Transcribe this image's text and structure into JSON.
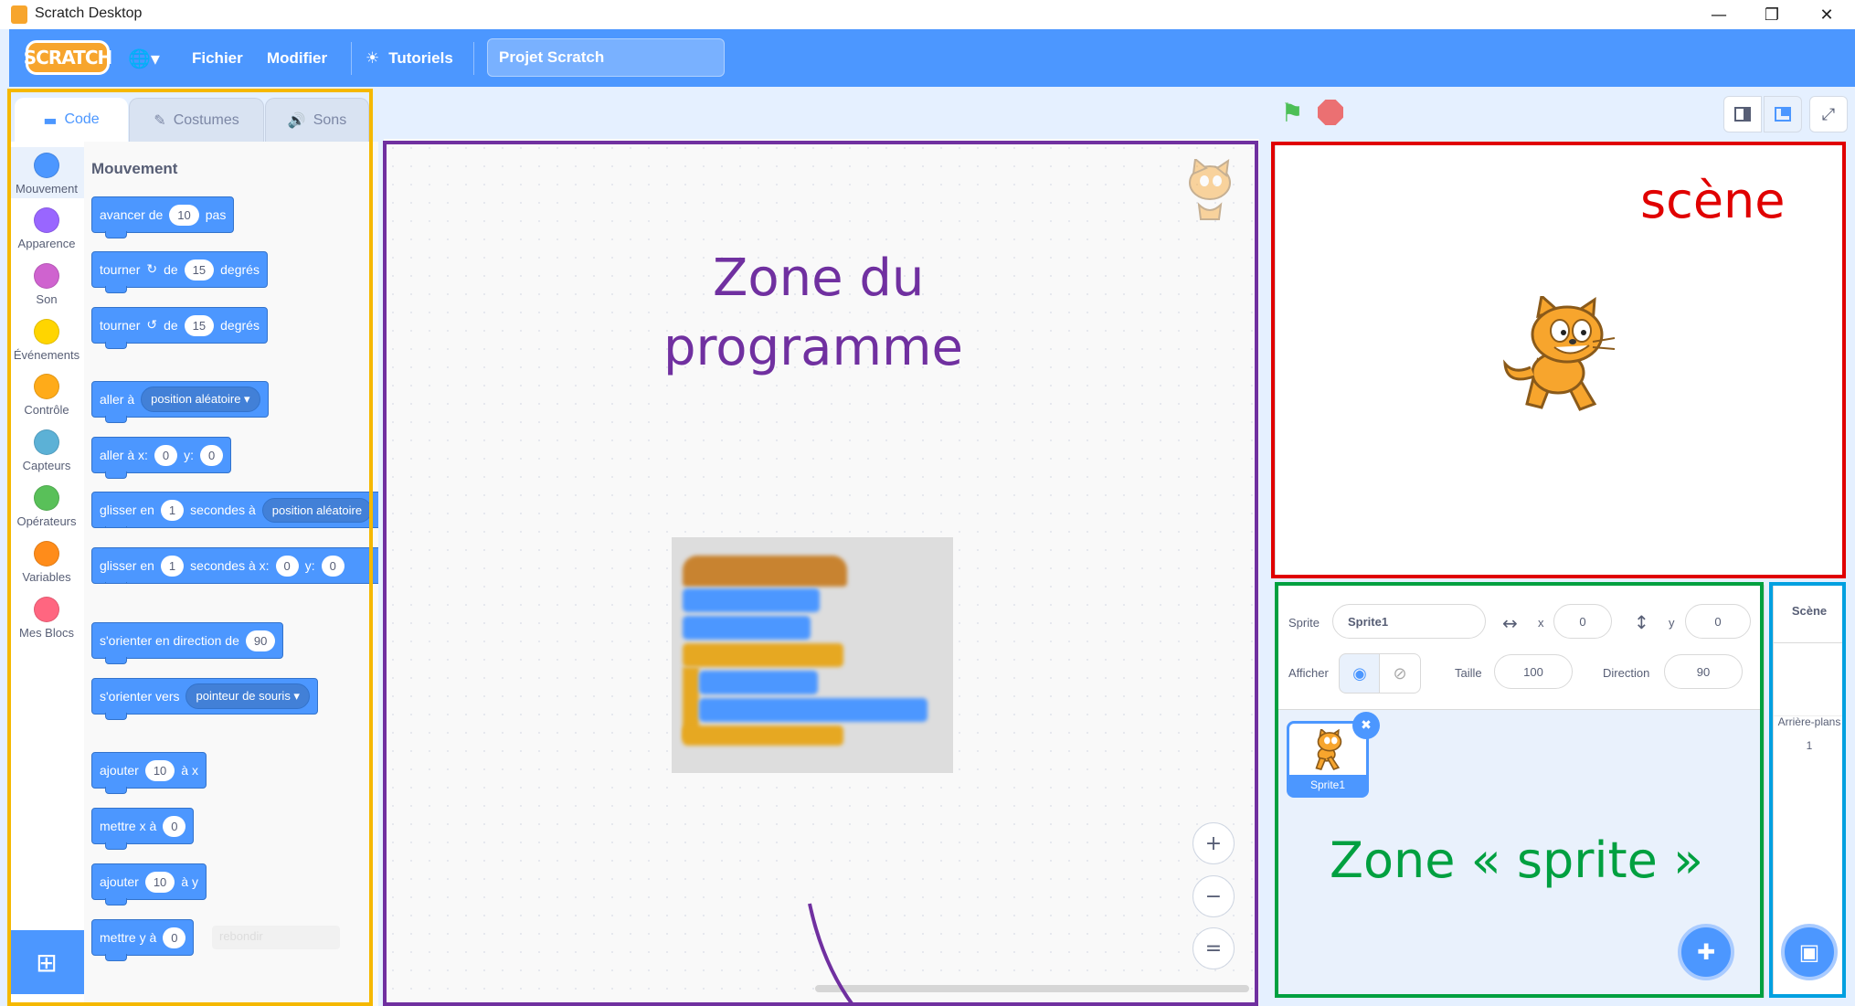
{
  "window": {
    "title": "Scratch Desktop",
    "minimize": "—",
    "restore": "❐",
    "close": "✕"
  },
  "menu": {
    "logo": "SCRATCH",
    "language_icon": "🌐▾",
    "file": "Fichier",
    "edit": "Modifier",
    "tutorials": "Tutoriels",
    "project_title": "Projet Scratch"
  },
  "tabs": {
    "code": "Code",
    "costumes": "Costumes",
    "sounds": "Sons"
  },
  "categories": [
    {
      "label": "Mouvement",
      "color": "#4c97ff"
    },
    {
      "label": "Apparence",
      "color": "#9966ff"
    },
    {
      "label": "Son",
      "color": "#cf63cf"
    },
    {
      "label": "Événements",
      "color": "#ffd500"
    },
    {
      "label": "Contrôle",
      "color": "#ffab19"
    },
    {
      "label": "Capteurs",
      "color": "#5cb1d6"
    },
    {
      "label": "Opérateurs",
      "color": "#59c059"
    },
    {
      "label": "Variables",
      "color": "#ff8c1a"
    },
    {
      "label": "Mes Blocs",
      "color": "#ff6680"
    }
  ],
  "palette": {
    "title": "Mouvement",
    "move": {
      "a": "avancer de",
      "v": "10",
      "b": "pas"
    },
    "turn_right": {
      "a": "tourner",
      "icon": "↻",
      "b": "de",
      "v": "15",
      "c": "degrés"
    },
    "turn_left": {
      "a": "tourner",
      "icon": "↺",
      "b": "de",
      "v": "15",
      "c": "degrés"
    },
    "goto": {
      "a": "aller à",
      "dd": "position aléatoire ▾"
    },
    "goto_xy": {
      "a": "aller à x:",
      "x": "0",
      "b": "y:",
      "y": "0"
    },
    "glide": {
      "a": "glisser en",
      "v": "1",
      "b": "secondes à",
      "dd": "position aléatoire"
    },
    "glide_xy": {
      "a": "glisser en",
      "v": "1",
      "b": "secondes à x:",
      "x": "0",
      "c": "y:",
      "y": "0"
    },
    "point_dir": {
      "a": "s'orienter en direction de",
      "v": "90"
    },
    "point_to": {
      "a": "s'orienter vers",
      "dd": "pointeur de souris ▾"
    },
    "change_x": {
      "a": "ajouter",
      "v": "10",
      "b": "à x"
    },
    "set_x": {
      "a": "mettre x à",
      "v": "0"
    },
    "change_y": {
      "a": "ajouter",
      "v": "10",
      "b": "à y"
    },
    "set_y": {
      "a": "mettre y à",
      "v": "0"
    },
    "ghost_text": "rebondir"
  },
  "code_area": {
    "zoom_in": "+",
    "zoom_out": "−",
    "reset": "="
  },
  "stage_controls": {
    "green_flag": "⚑",
    "stop": "⬣"
  },
  "sprite_info": {
    "sprite_label": "Sprite",
    "sprite_name": "Sprite1",
    "x_label": "x",
    "x_value": "0",
    "y_label": "y",
    "y_value": "0",
    "show_label": "Afficher",
    "size_label": "Taille",
    "size_value": "100",
    "direction_label": "Direction",
    "direction_value": "90"
  },
  "sprites": [
    {
      "name": "Sprite1"
    }
  ],
  "stage_pane": {
    "title": "Scène",
    "backdrops_label": "Arrière-plans",
    "backdrops_count": "1"
  },
  "annotations": {
    "program_zone_line1": "Zone du",
    "program_zone_line2": "programme",
    "stage_label": "scène",
    "sprite_zone": "Zone « sprite »",
    "colors": {
      "palette": "#f5b800",
      "program": "#7030a0",
      "stage": "#e00000",
      "sprite": "#00a040",
      "stage_pane": "#00a0e0"
    }
  }
}
